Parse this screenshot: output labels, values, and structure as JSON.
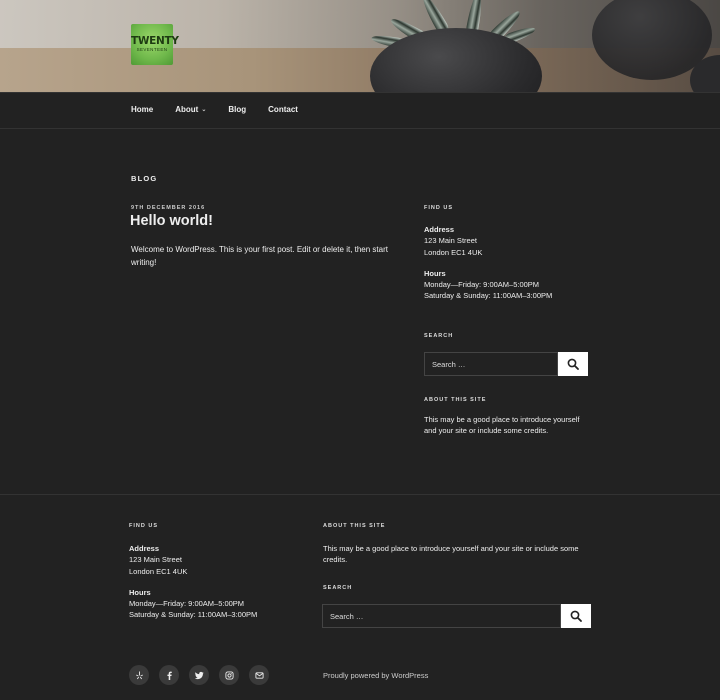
{
  "site": {
    "logo": {
      "line1": "TWENTY",
      "line2": "SEVENTEEN"
    }
  },
  "nav": {
    "items": [
      {
        "label": "Home",
        "has_submenu": false
      },
      {
        "label": "About",
        "has_submenu": true
      },
      {
        "label": "Blog",
        "has_submenu": false
      },
      {
        "label": "Contact",
        "has_submenu": false
      }
    ]
  },
  "main": {
    "page_title": "BLOG",
    "post": {
      "date": "9TH DECEMBER 2016",
      "title": "Hello world!",
      "body": "Welcome to WordPress. This is your first post. Edit or delete it, then start writing!"
    }
  },
  "sidebar": {
    "find_us": {
      "title": "FIND US",
      "address_label": "Address",
      "address_line1": "123 Main Street",
      "address_line2": "London EC1 4UK",
      "hours_label": "Hours",
      "hours_line1": "Monday—Friday: 9:00AM–5:00PM",
      "hours_line2": "Saturday & Sunday: 11:00AM–3:00PM"
    },
    "search": {
      "title": "SEARCH",
      "placeholder": "Search …"
    },
    "about": {
      "title": "ABOUT THIS SITE",
      "text": "This may be a good place to introduce yourself and your site or include some credits."
    }
  },
  "footer": {
    "find_us": {
      "title": "FIND US",
      "address_label": "Address",
      "address_line1": "123 Main Street",
      "address_line2": "London EC1 4UK",
      "hours_label": "Hours",
      "hours_line1": "Monday—Friday: 9:00AM–5:00PM",
      "hours_line2": "Saturday & Sunday: 11:00AM–3:00PM"
    },
    "about": {
      "title": "ABOUT THIS SITE",
      "text": "This may be a good place to introduce yourself and your site or include some credits."
    },
    "search": {
      "title": "SEARCH",
      "placeholder": "Search …"
    },
    "social": [
      "yelp-icon",
      "facebook-icon",
      "twitter-icon",
      "instagram-icon",
      "email-icon"
    ],
    "credit": "Proudly powered by WordPress"
  },
  "colors": {
    "background": "#222222",
    "text": "#eeeeee",
    "button": "#ffffff"
  }
}
